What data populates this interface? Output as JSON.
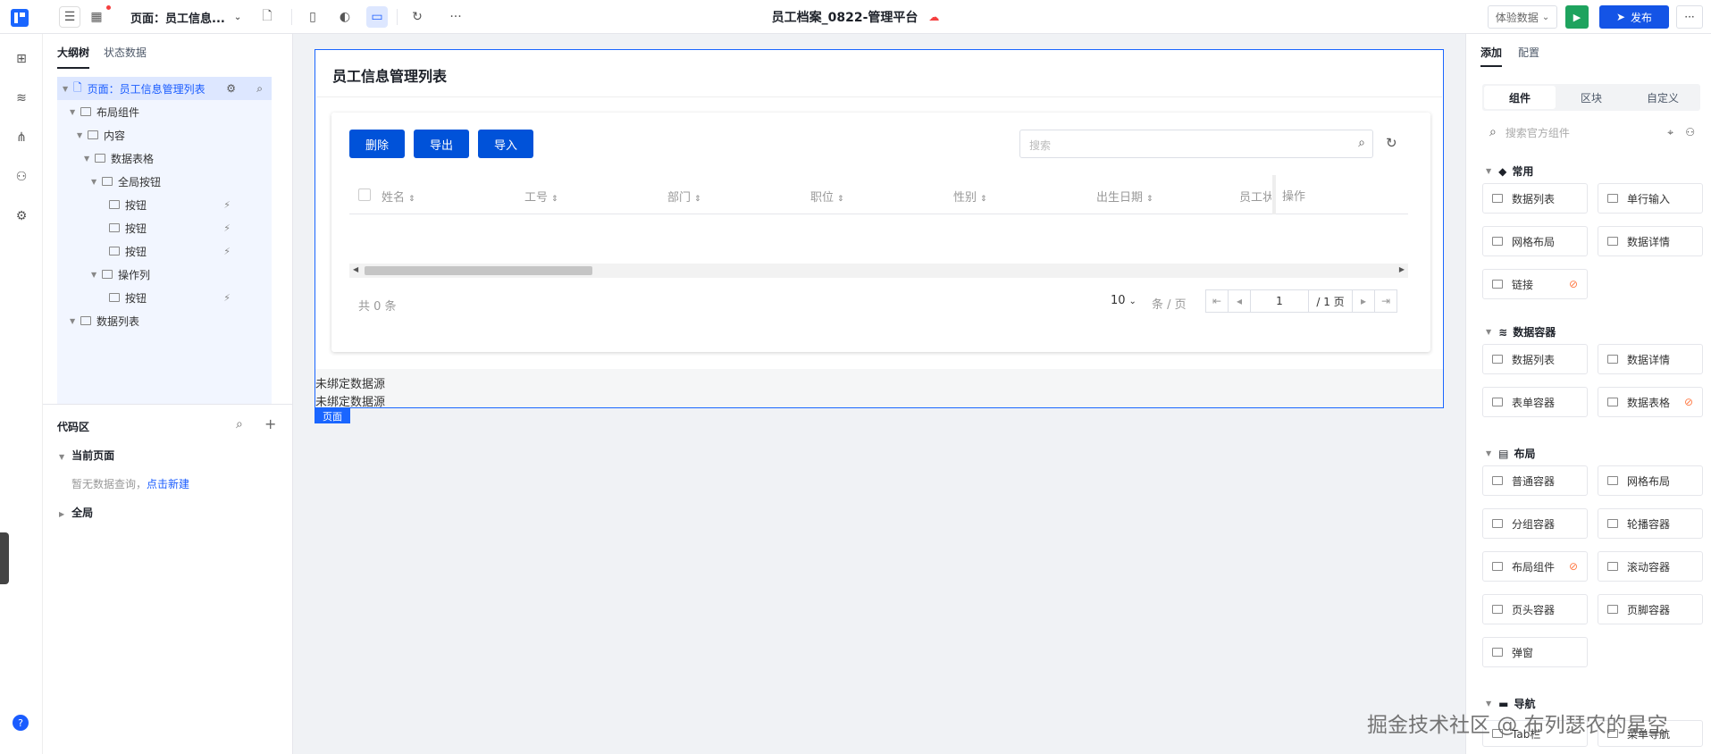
{
  "topbar": {
    "page_selector": "页面：员工信息...",
    "app_title": "员工档案_0822-管理平台",
    "experience_data": "体验数据",
    "publish": "发布",
    "more": "···"
  },
  "rail": {
    "help": "?"
  },
  "left_panel": {
    "tabs": [
      "大纲树",
      "状态数据"
    ],
    "tree": [
      {
        "label": "页面：员工信息管理列表",
        "depth": 0,
        "selected": true
      },
      {
        "label": "布局组件",
        "depth": 1
      },
      {
        "label": "内容",
        "depth": 2
      },
      {
        "label": "数据表格",
        "depth": 3
      },
      {
        "label": "全局按钮",
        "depth": 4
      },
      {
        "label": "按钮",
        "depth": 5,
        "event": true
      },
      {
        "label": "按钮",
        "depth": 5,
        "event": true
      },
      {
        "label": "按钮",
        "depth": 5,
        "event": true
      },
      {
        "label": "操作列",
        "depth": 4
      },
      {
        "label": "按钮",
        "depth": 5,
        "event": true
      },
      {
        "label": "数据列表",
        "depth": 1
      }
    ],
    "code_zone": {
      "title": "代码区",
      "current_page": "当前页面",
      "empty_text": "暂无数据查询，",
      "create_link": "点击新建",
      "global": "全局"
    }
  },
  "canvas": {
    "page_title": "员工信息管理列表",
    "buttons": [
      "删除",
      "导出",
      "导入"
    ],
    "search_placeholder": "搜索",
    "columns": [
      "姓名",
      "工号",
      "部门",
      "职位",
      "性别",
      "出生日期",
      "员工状",
      "操作"
    ],
    "total": "共 0 条",
    "page_size": "10",
    "per_page_unit": "条 / 页",
    "current_page": "1",
    "total_pages": "/ 1 页",
    "unbound_1": "未绑定数据源",
    "unbound_2": "未绑定数据源",
    "page_tag": "页面"
  },
  "right_panel": {
    "tabs": [
      "添加",
      "配置"
    ],
    "segments": [
      "组件",
      "区块",
      "自定义"
    ],
    "search_placeholder": "搜索官方组件",
    "groups": [
      {
        "title": "常用",
        "items": [
          "数据列表",
          "单行输入",
          "网格布局",
          "数据详情",
          "链接"
        ]
      },
      {
        "title": "数据容器",
        "items": [
          "数据列表",
          "数据详情",
          "表单容器",
          "数据表格"
        ]
      },
      {
        "title": "布局",
        "items": [
          "普通容器",
          "网格布局",
          "分组容器",
          "轮播容器",
          "布局组件",
          "滚动容器",
          "页头容器",
          "页脚容器",
          "弹窗"
        ]
      },
      {
        "title": "导航",
        "items": [
          "Tab栏",
          "菜单导航"
        ]
      }
    ]
  },
  "watermark": "掘金技术社区 @ 布列瑟农的星空",
  "colors": {
    "primary": "#0052d9",
    "brand": "#1a66ff",
    "run": "#1ea35e"
  }
}
